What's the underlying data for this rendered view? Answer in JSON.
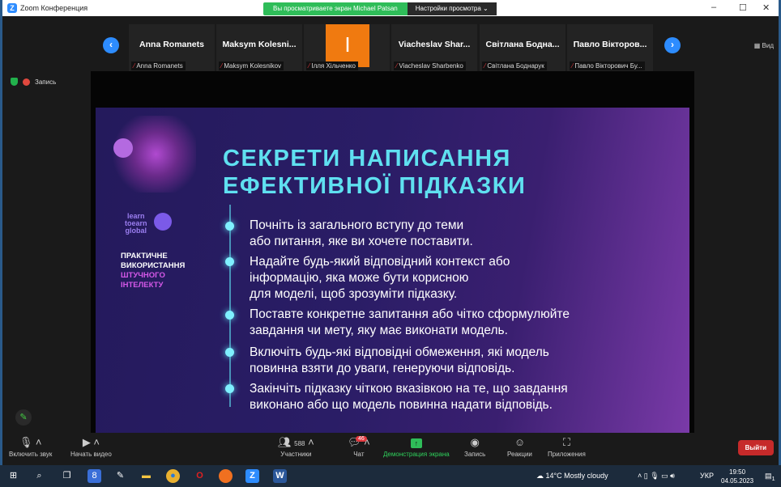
{
  "window": {
    "title": "Zoom Конференция",
    "minimize": "–",
    "maximize": "☐",
    "close": "✕"
  },
  "banner": {
    "viewing": "Вы просматриваете экран Michael Patsan",
    "options": "Настройки просмотра",
    "chevron": "⌄"
  },
  "view_button": "Вид",
  "participants": [
    {
      "name": "Anna Romanets",
      "label": "Anna Romanets"
    },
    {
      "name": "Maksym  Kolesni...",
      "label": "Maksym Kolesnikov"
    },
    {
      "name": "I",
      "label": "Ілля Хільченко"
    },
    {
      "name": "Viacheslav  Shar...",
      "label": "Viacheslav Sharbenko"
    },
    {
      "name": "Світлана  Бодна...",
      "label": "Світлана Боднарук"
    },
    {
      "name": "Павло  Вікторов...",
      "label": "Павло Вікторович Бу..."
    }
  ],
  "recording": "Запись",
  "slide": {
    "title": [
      "СЕКРЕТИ НАПИСАННЯ",
      "ЕФЕКТИВНОЇ ПІДКАЗКИ"
    ],
    "logo": [
      "learn",
      "toearn",
      "global"
    ],
    "side": [
      "ПРАКТИЧНЕ",
      "ВИКОРИСТАННЯ",
      "ШТУЧНОГО",
      "ІНТЕЛЕКТУ"
    ],
    "bullets": [
      [
        "Почніть із загального вступу до теми",
        "або питання, яке ви хочете поставити."
      ],
      [
        "Надайте будь-який відповідний контекст або",
        "інформацію, яка може бути корисною",
        "для моделі, щоб зрозуміти підказку."
      ],
      [
        "Поставте конкретне запитання або чітко сформулюйте",
        "завдання чи мету, яку має виконати модель."
      ],
      [
        "Включіть будь-які відповідні обмеження, які модель",
        "повинна взяти до уваги, генеруючи відповідь."
      ],
      [
        "Закінчіть підказку чіткою вказівкою на те, що завдання",
        "виконано або що модель повинна надати відповідь."
      ]
    ]
  },
  "toolbar": {
    "mute": "Включить звук",
    "video": "Начать видео",
    "participants": "Участники",
    "participants_count": "588",
    "chat": "Чат",
    "chat_badge": "46",
    "share": "Демонстрация экрана",
    "record": "Запись",
    "reactions": "Реакции",
    "apps": "Приложения",
    "leave": "Выйти"
  },
  "taskbar": {
    "weather": "14°C  Mostly cloudy",
    "lang": "УКР",
    "time": "19:50",
    "date": "04.05.2023",
    "notifications": "1"
  },
  "colors": {
    "accent": "#2d8cff",
    "title": "#5fe0f0",
    "share_green": "#2fbd59",
    "leave": "#c62a2a"
  }
}
